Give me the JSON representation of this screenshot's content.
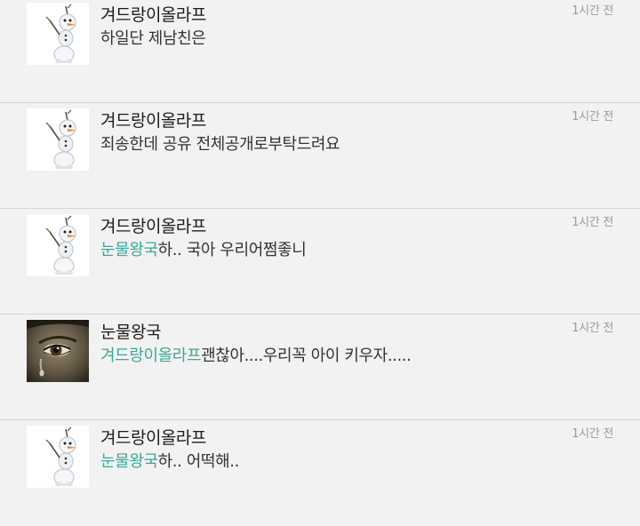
{
  "comments": [
    {
      "avatar_icon": "snowman-avatar-icon",
      "author": "겨드랑이올라프",
      "mention": "",
      "text": "하일단 제남친은",
      "time": "1시간 전"
    },
    {
      "avatar_icon": "snowman-avatar-icon",
      "author": "겨드랑이올라프",
      "mention": "",
      "text": "죄송한데 공유 전체공개로부탁드려요",
      "time": "1시간 전"
    },
    {
      "avatar_icon": "snowman-avatar-icon",
      "author": "겨드랑이올라프",
      "mention": "눈물왕국",
      "text": "하.. 국아 우리어쩜좋니",
      "time": "1시간 전"
    },
    {
      "avatar_icon": "crying-eye-avatar-icon",
      "author": "눈물왕국",
      "mention": "겨드랑이올라프",
      "text": "괜찮아....우리꼭 아이 키우자.....",
      "time": "1시간 전"
    },
    {
      "avatar_icon": "snowman-avatar-icon",
      "author": "겨드랑이올라프",
      "mention": "눈물왕국",
      "text": "하.. 어떡해..",
      "time": "1시간 전"
    }
  ],
  "colors": {
    "background": "#f2f2f2",
    "mention": "#3aa89a",
    "divider": "#d6d6d6"
  }
}
